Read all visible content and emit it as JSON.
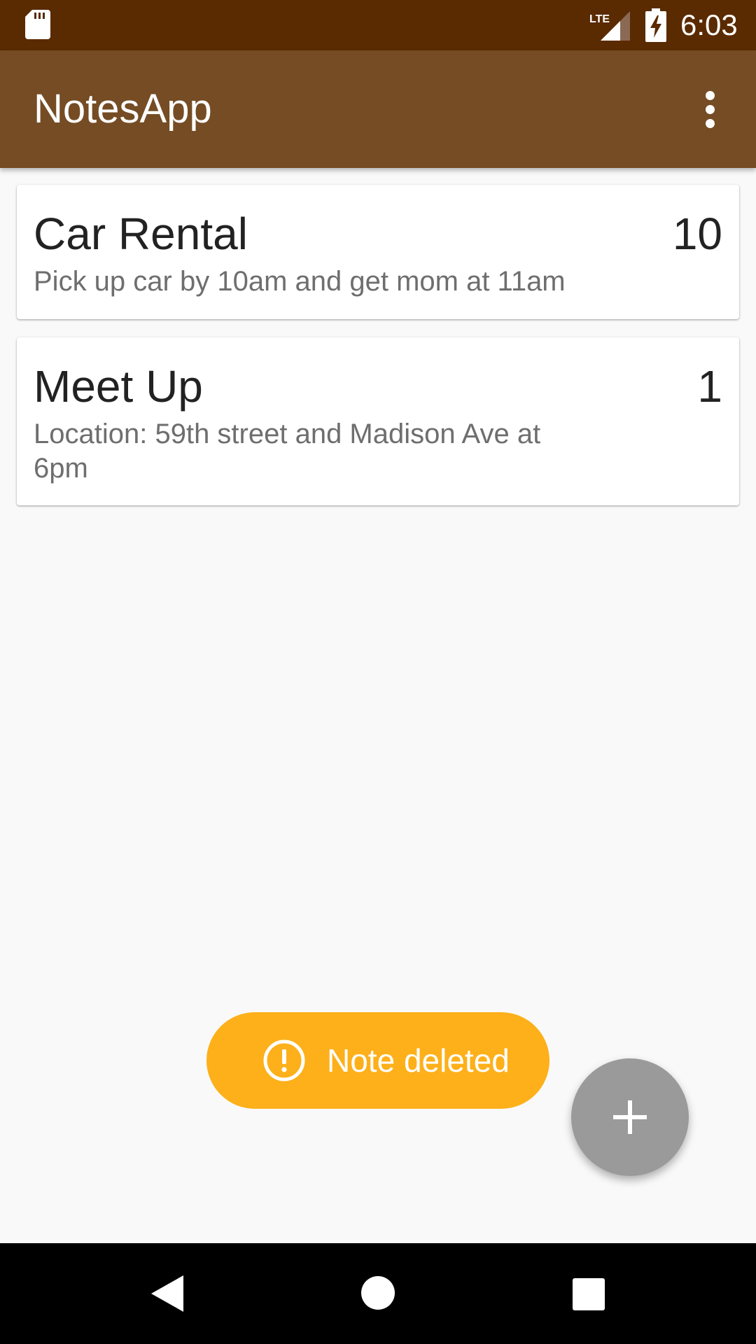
{
  "status_bar": {
    "time": "6:03",
    "network": "LTE",
    "icons": [
      "sd-card-icon",
      "lte-signal-icon",
      "battery-charging-icon"
    ]
  },
  "app_bar": {
    "title": "NotesApp",
    "menu_icon": "more-vert-icon"
  },
  "notes": [
    {
      "title": "Car Rental",
      "priority": "10",
      "description": "Pick up car by 10am and get mom at 11am"
    },
    {
      "title": "Meet Up",
      "priority": "1",
      "description": "Location: 59th street and Madison Ave at 6pm"
    }
  ],
  "toast": {
    "icon": "alert-circle-icon",
    "message": "Note deleted"
  },
  "fab": {
    "icon": "plus-icon"
  },
  "nav_bar": {
    "icons": [
      "back-icon",
      "home-icon",
      "recents-icon"
    ]
  },
  "colors": {
    "status_bar": "#5a2a00",
    "app_bar": "#754c24",
    "toast": "#fdb01a",
    "fab": "#9a9a9a",
    "background": "#f9f9f9"
  }
}
